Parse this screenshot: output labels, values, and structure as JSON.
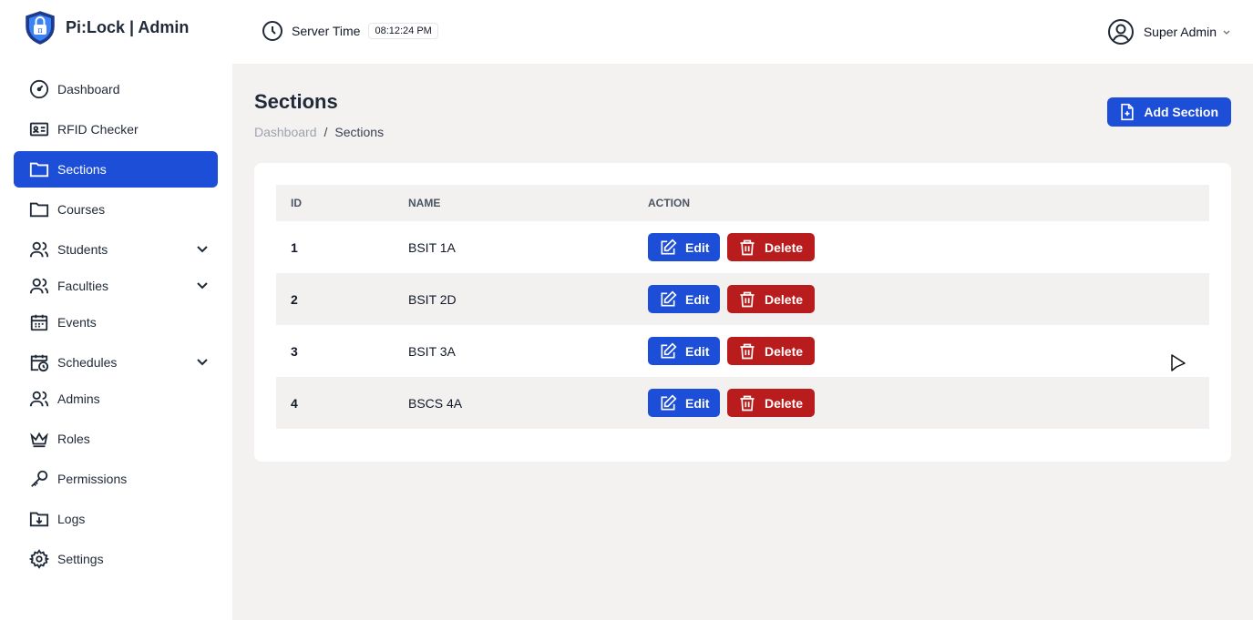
{
  "app": {
    "title": "Pi:Lock | Admin"
  },
  "header": {
    "server_label": "Server Time",
    "server_time": "08:12:24 PM",
    "user_name": "Super Admin"
  },
  "sidebar": {
    "items": [
      {
        "label": "Dashboard",
        "icon": "gauge-icon"
      },
      {
        "label": "RFID Checker",
        "icon": "id-card-icon"
      },
      {
        "label": "Sections",
        "icon": "folder-icon",
        "active": true
      },
      {
        "label": "Courses",
        "icon": "folder-icon"
      },
      {
        "label": "Students",
        "icon": "users-icon",
        "expandable": true
      },
      {
        "label": "Faculties",
        "icon": "users-icon",
        "expandable": true
      },
      {
        "label": "Events",
        "icon": "calendar-icon"
      },
      {
        "label": "Schedules",
        "icon": "calendar-clock-icon",
        "expandable": true
      },
      {
        "label": "Admins",
        "icon": "users-icon"
      },
      {
        "label": "Roles",
        "icon": "crown-icon"
      },
      {
        "label": "Permissions",
        "icon": "key-icon"
      },
      {
        "label": "Logs",
        "icon": "folder-download-icon"
      },
      {
        "label": "Settings",
        "icon": "gear-icon"
      }
    ]
  },
  "page": {
    "title": "Sections",
    "breadcrumb": {
      "parent": "Dashboard",
      "separator": "/",
      "current": "Sections"
    },
    "add_button": "Add Section"
  },
  "table": {
    "headers": [
      "ID",
      "NAME",
      "ACTION"
    ],
    "rows": [
      {
        "id": "1",
        "name": "BSIT 1A"
      },
      {
        "id": "2",
        "name": "BSIT 2D"
      },
      {
        "id": "3",
        "name": "BSIT 3A"
      },
      {
        "id": "4",
        "name": "BSCS 4A"
      }
    ],
    "edit_label": "Edit",
    "delete_label": "Delete"
  },
  "colors": {
    "primary": "#1d4ed8",
    "danger": "#b91c1c",
    "main_bg": "#f3f2f1"
  }
}
